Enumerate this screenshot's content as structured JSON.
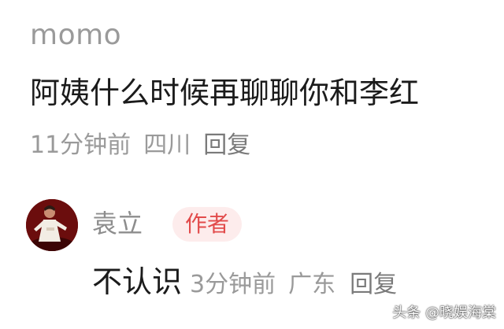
{
  "comment": {
    "username": "momo",
    "text": "阿姨什么时候再聊聊你和李红",
    "time": "11分钟前",
    "location": "四川",
    "reply_label": "回复"
  },
  "reply": {
    "username": "袁立",
    "author_badge": "作者",
    "text": "不认识",
    "time": "3分钟前",
    "location": "广东",
    "reply_label": "回复"
  },
  "watermark": "头条 @晓娱海棠",
  "colors": {
    "muted_text": "#9a9a9a",
    "main_text": "#1b1b1b",
    "badge_bg": "#fdecec",
    "badge_text": "#e24b4b"
  }
}
